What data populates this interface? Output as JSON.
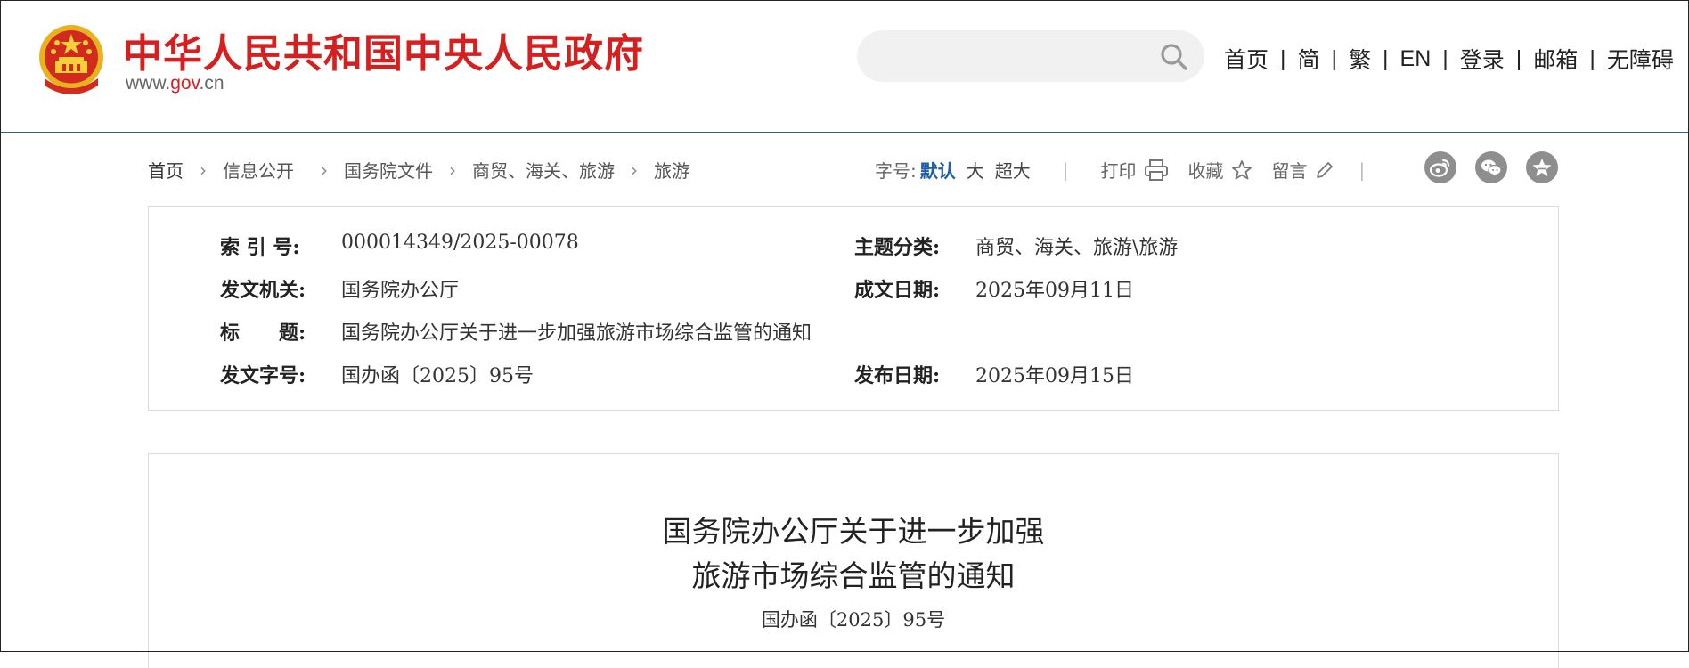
{
  "header": {
    "site_name": "中华人民共和国中央人民政府",
    "domain_prefix": "www.",
    "domain_gov": "gov",
    "domain_suffix": ".cn",
    "search_placeholder": "",
    "nav": [
      "首页",
      "简",
      "繁",
      "EN",
      "登录",
      "邮箱",
      "无障碍"
    ],
    "nav_separator": "|"
  },
  "breadcrumb": [
    "首页",
    "信息公开",
    "国务院文件",
    "商贸、海关、旅游",
    "旅游"
  ],
  "tools": {
    "font_size_label": "字号:",
    "font_sizes": [
      "默认",
      "大",
      "超大"
    ],
    "print_label": "打印",
    "favorite_label": "收藏",
    "comment_label": "留言",
    "divider": "|"
  },
  "share_icons": [
    "weibo-icon",
    "wechat-icon",
    "favorite-star-icon"
  ],
  "meta": {
    "index_label": "索 引 号:",
    "index_value": "000014349/2025-00078",
    "topic_label": "主题分类:",
    "topic_value": "商贸、海关、旅游\\旅游",
    "issuer_label": "发文机关:",
    "issuer_value": "国务院办公厅",
    "written_date_label": "成文日期:",
    "written_date_value": "2025年09月11日",
    "title_label": "标　　题:",
    "title_value": "国务院办公厅关于进一步加强旅游市场综合监管的通知",
    "doc_no_label": "发文字号:",
    "doc_no_value": "国办函〔2025〕95号",
    "publish_date_label": "发布日期:",
    "publish_date_value": "2025年09月15日"
  },
  "article": {
    "title_line1": "国务院办公厅关于进一步加强",
    "title_line2": "旅游市场综合监管的通知",
    "doc_number": "国办函〔2025〕95号"
  },
  "colors": {
    "brand_red": "#d61f1f",
    "link_blue": "#1d5fa7",
    "header_rule": "#3a5f8a"
  }
}
